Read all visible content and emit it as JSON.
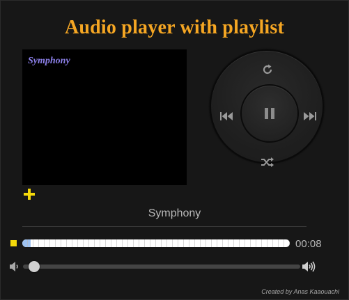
{
  "title": "Audio player with playlist",
  "now_playing": {
    "art_label": "Symphony",
    "track_name": "Symphony"
  },
  "controls": {
    "repeat_icon": "repeat-icon",
    "previous_icon": "previous-icon",
    "pause_icon": "pause-icon",
    "next_icon": "next-icon",
    "shuffle_icon": "shuffle-icon",
    "add_icon": "plus-icon"
  },
  "progress": {
    "elapsed": "00:08",
    "fraction": 0.03
  },
  "volume": {
    "level": 0.02,
    "low_icon": "volume-low-icon",
    "high_icon": "volume-high-icon"
  },
  "footer": {
    "credit": "Created by Anas Kaaouachi"
  },
  "colors": {
    "accent": "#f5a623",
    "add": "#f5d90a",
    "progress_fill": "#9ec2f1",
    "art_label": "#8b7fe8"
  }
}
